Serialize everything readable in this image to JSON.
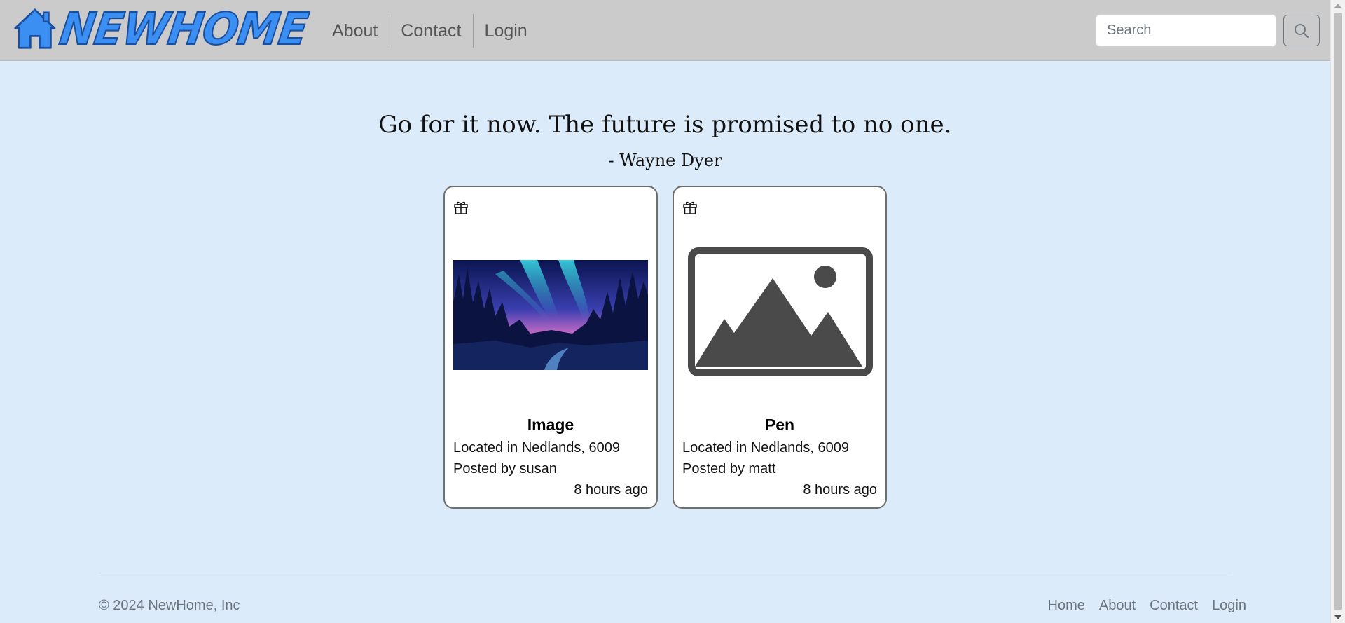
{
  "navbar": {
    "brand": "NEWHOME",
    "links": [
      "About",
      "Contact",
      "Login"
    ],
    "search_placeholder": "Search",
    "search_value": ""
  },
  "quote": {
    "text": "Go for it now. The future is promised to no one.",
    "author": "- Wayne Dyer"
  },
  "cards": [
    {
      "title": "Image",
      "location": "Located in Nedlands, 6009",
      "poster": "Posted by susan",
      "time": "8 hours ago",
      "image": "aurora-forest-photo"
    },
    {
      "title": "Pen",
      "location": "Located in Nedlands, 6009",
      "poster": "Posted by matt",
      "time": "8 hours ago",
      "image": "image-placeholder-icon"
    }
  ],
  "footer": {
    "copyright": "© 2024 NewHome, Inc",
    "links": [
      "Home",
      "About",
      "Contact",
      "Login"
    ]
  },
  "colors": {
    "page_background": "#dbebfa",
    "navbar_background": "#cbcbcb",
    "brand_blue": "#3b8ff2",
    "card_border": "#6f6f6f"
  },
  "icons": [
    "house-icon",
    "search-icon",
    "gift-icon",
    "image-placeholder-icon"
  ]
}
